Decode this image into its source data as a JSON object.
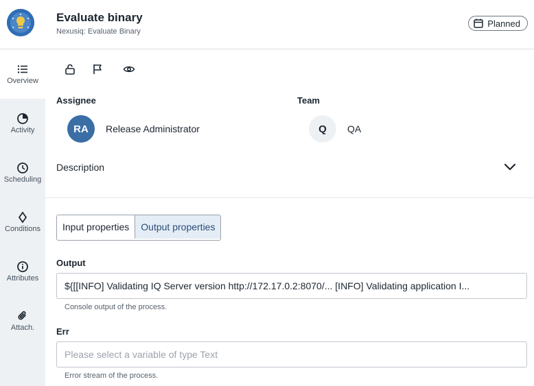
{
  "header": {
    "title": "Evaluate binary",
    "subtitle": "Nexusiq: Evaluate Binary",
    "status": "Planned"
  },
  "sidebar": {
    "items": [
      {
        "label": "Overview",
        "icon": "list-icon",
        "active": true
      },
      {
        "label": "Activity",
        "icon": "activity-icon"
      },
      {
        "label": "Scheduling",
        "icon": "clock-icon"
      },
      {
        "label": "Conditions",
        "icon": "diamond-icon"
      },
      {
        "label": "Attributes",
        "icon": "info-icon"
      },
      {
        "label": "Attach.",
        "icon": "paperclip-icon"
      }
    ]
  },
  "toolbar": {
    "icons": [
      "unlock-icon",
      "flag-icon",
      "eye-icon"
    ]
  },
  "assignee": {
    "label": "Assignee",
    "initials": "RA",
    "name": "Release Administrator",
    "avatar_color": "#3a6ea5"
  },
  "team": {
    "label": "Team",
    "initials": "Q",
    "name": "QA",
    "avatar_color": "#eef1f4"
  },
  "description": {
    "label": "Description"
  },
  "tabs": {
    "input": "Input properties",
    "output": "Output properties",
    "selected": "output"
  },
  "output_field": {
    "label": "Output",
    "value": "${[[INFO] Validating IQ Server version http://172.17.0.2:8070/... [INFO] Validating application I...",
    "hint": "Console output of the process."
  },
  "err_field": {
    "label": "Err",
    "placeholder": "Please select a variable of type Text",
    "hint": "Error stream of the process."
  },
  "colors": {
    "accent": "#2f6db5",
    "selected_tab_bg": "#e4ecf5",
    "sidebar_bg": "#eef1f4"
  }
}
